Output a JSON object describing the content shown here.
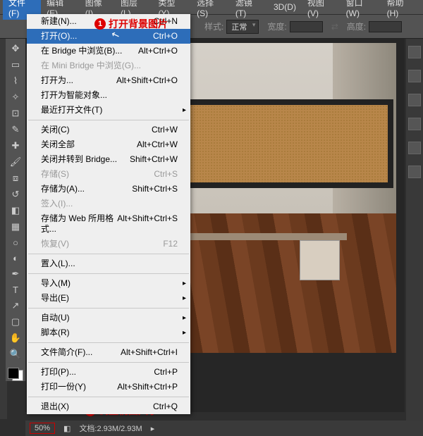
{
  "menubar": {
    "items": [
      "文件(F)",
      "编辑(E)",
      "图像(I)",
      "图层(L)",
      "类型(Y)",
      "选择(S)",
      "滤镜(T)",
      "3D(D)",
      "视图(V)",
      "窗口(W)",
      "帮助(H)"
    ],
    "active_index": 0
  },
  "options": {
    "style_label": "样式:",
    "style_value": "正常",
    "width_label": "宽度:",
    "height_label": "高度:"
  },
  "file_menu": [
    {
      "label": "新建(N)...",
      "shortcut": "Ctrl+N"
    },
    {
      "label": "打开(O)...",
      "shortcut": "Ctrl+O",
      "highlight": true
    },
    {
      "label": "在 Bridge 中浏览(B)...",
      "shortcut": "Alt+Ctrl+O"
    },
    {
      "label": "在 Mini Bridge 中浏览(G)...",
      "shortcut": "",
      "disabled": true
    },
    {
      "label": "打开为...",
      "shortcut": "Alt+Shift+Ctrl+O"
    },
    {
      "label": "打开为智能对象...",
      "shortcut": ""
    },
    {
      "label": "最近打开文件(T)",
      "shortcut": "",
      "sub": true
    },
    {
      "sep": true
    },
    {
      "label": "关闭(C)",
      "shortcut": "Ctrl+W"
    },
    {
      "label": "关闭全部",
      "shortcut": "Alt+Ctrl+W"
    },
    {
      "label": "关闭并转到 Bridge...",
      "shortcut": "Shift+Ctrl+W"
    },
    {
      "label": "存储(S)",
      "shortcut": "Ctrl+S",
      "disabled": true
    },
    {
      "label": "存储为(A)...",
      "shortcut": "Shift+Ctrl+S"
    },
    {
      "label": "签入(I)...",
      "shortcut": "",
      "disabled": true
    },
    {
      "label": "存储为 Web 所用格式...",
      "shortcut": "Alt+Shift+Ctrl+S"
    },
    {
      "label": "恢复(V)",
      "shortcut": "F12",
      "disabled": true
    },
    {
      "sep": true
    },
    {
      "label": "置入(L)...",
      "shortcut": ""
    },
    {
      "sep": true
    },
    {
      "label": "导入(M)",
      "shortcut": "",
      "sub": true
    },
    {
      "label": "导出(E)",
      "shortcut": "",
      "sub": true
    },
    {
      "sep": true
    },
    {
      "label": "自动(U)",
      "shortcut": "",
      "sub": true
    },
    {
      "label": "脚本(R)",
      "shortcut": "",
      "sub": true
    },
    {
      "sep": true
    },
    {
      "label": "文件简介(F)...",
      "shortcut": "Alt+Shift+Ctrl+I"
    },
    {
      "sep": true
    },
    {
      "label": "打印(P)...",
      "shortcut": "Ctrl+P"
    },
    {
      "label": "打印一份(Y)",
      "shortcut": "Alt+Shift+Ctrl+P"
    },
    {
      "sep": true
    },
    {
      "label": "退出(X)",
      "shortcut": "Ctrl+Q"
    }
  ],
  "annotations": {
    "c1": "打开背景图片",
    "c2": "调整视图大小"
  },
  "status": {
    "zoom": "50%",
    "doc_label": "文档:",
    "doc": "2.93M/2.93M"
  },
  "tools": [
    "move",
    "marquee",
    "lasso",
    "wand",
    "crop",
    "eyedropper",
    "heal",
    "brush",
    "stamp",
    "history",
    "eraser",
    "gradient",
    "blur",
    "dodge",
    "pen",
    "type",
    "path",
    "shape",
    "hand",
    "zoom"
  ],
  "panels": [
    "color",
    "swatch",
    "adjust",
    "layers",
    "channels",
    "paths"
  ]
}
